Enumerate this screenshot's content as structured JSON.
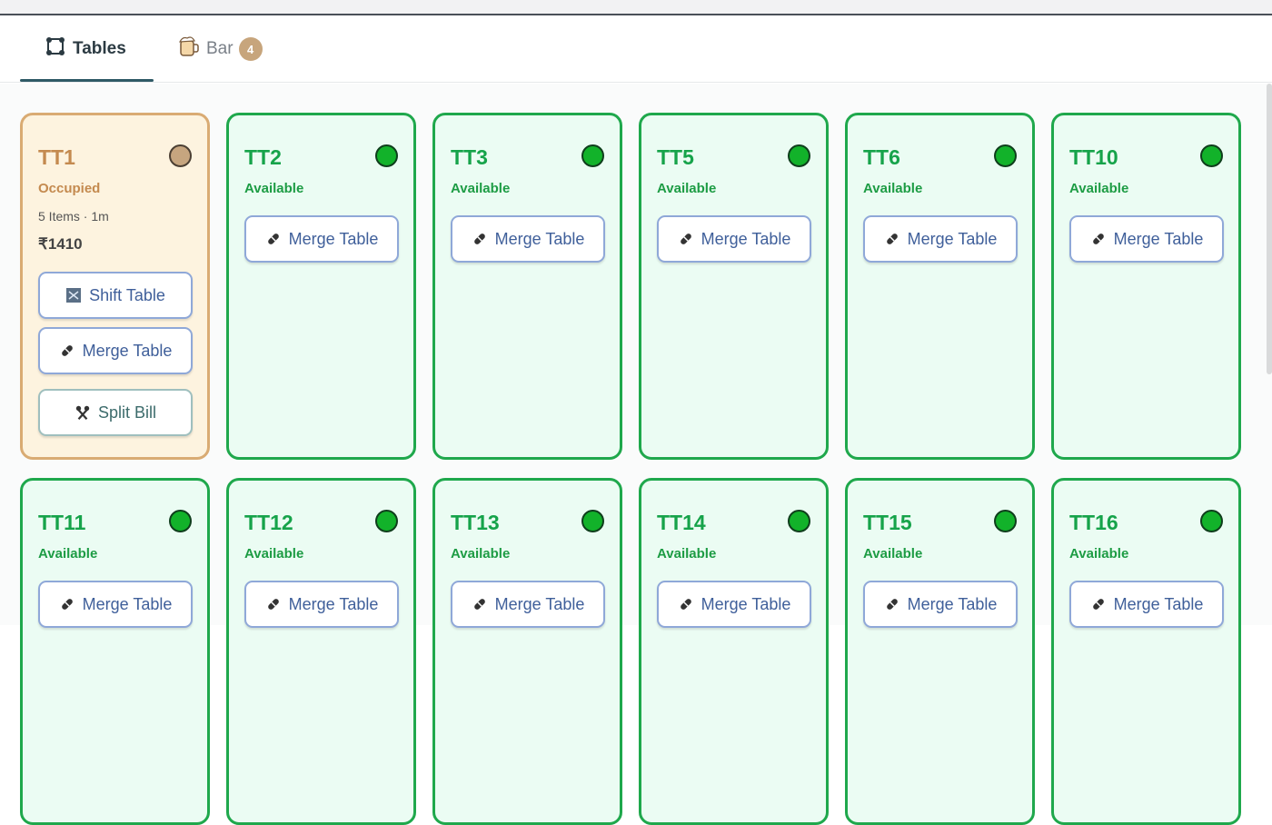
{
  "tabs": [
    {
      "label": "Tables",
      "icon": "table-grid-icon",
      "active": true
    },
    {
      "label": "Bar",
      "icon": "beer-mug-icon",
      "badge": "4",
      "active": false
    }
  ],
  "colors": {
    "available": "#16a34a",
    "occupied": "#c48a4f",
    "button_text": "#3f5f9a"
  },
  "tables": [
    {
      "name": "TT1",
      "status": "Occupied",
      "meta": "5 Items · 1m",
      "amount": "₹1410",
      "occupied": true,
      "buttons": [
        {
          "label": "Shift Table",
          "icon": "shift-icon"
        },
        {
          "label": "Merge Table",
          "icon": "merge-icon"
        },
        {
          "label": "Split Bill",
          "icon": "split-icon"
        }
      ]
    },
    {
      "name": "TT2",
      "status": "Available",
      "occupied": false,
      "buttons": [
        {
          "label": "Merge Table",
          "icon": "merge-icon"
        }
      ]
    },
    {
      "name": "TT3",
      "status": "Available",
      "occupied": false,
      "buttons": [
        {
          "label": "Merge Table",
          "icon": "merge-icon"
        }
      ]
    },
    {
      "name": "TT5",
      "status": "Available",
      "occupied": false,
      "buttons": [
        {
          "label": "Merge Table",
          "icon": "merge-icon"
        }
      ]
    },
    {
      "name": "TT6",
      "status": "Available",
      "occupied": false,
      "buttons": [
        {
          "label": "Merge Table",
          "icon": "merge-icon"
        }
      ]
    },
    {
      "name": "TT10",
      "status": "Available",
      "occupied": false,
      "buttons": [
        {
          "label": "Merge Table",
          "icon": "merge-icon"
        }
      ]
    },
    {
      "name": "TT11",
      "status": "Available",
      "occupied": false,
      "buttons": [
        {
          "label": "Merge Table",
          "icon": "merge-icon"
        }
      ]
    },
    {
      "name": "TT12",
      "status": "Available",
      "occupied": false,
      "buttons": [
        {
          "label": "Merge Table",
          "icon": "merge-icon"
        }
      ]
    },
    {
      "name": "TT13",
      "status": "Available",
      "occupied": false,
      "buttons": [
        {
          "label": "Merge Table",
          "icon": "merge-icon"
        }
      ]
    },
    {
      "name": "TT14",
      "status": "Available",
      "occupied": false,
      "buttons": [
        {
          "label": "Merge Table",
          "icon": "merge-icon"
        }
      ]
    },
    {
      "name": "TT15",
      "status": "Available",
      "occupied": false,
      "buttons": [
        {
          "label": "Merge Table",
          "icon": "merge-icon"
        }
      ]
    },
    {
      "name": "TT16",
      "status": "Available",
      "occupied": false,
      "buttons": [
        {
          "label": "Merge Table",
          "icon": "merge-icon"
        }
      ]
    }
  ]
}
